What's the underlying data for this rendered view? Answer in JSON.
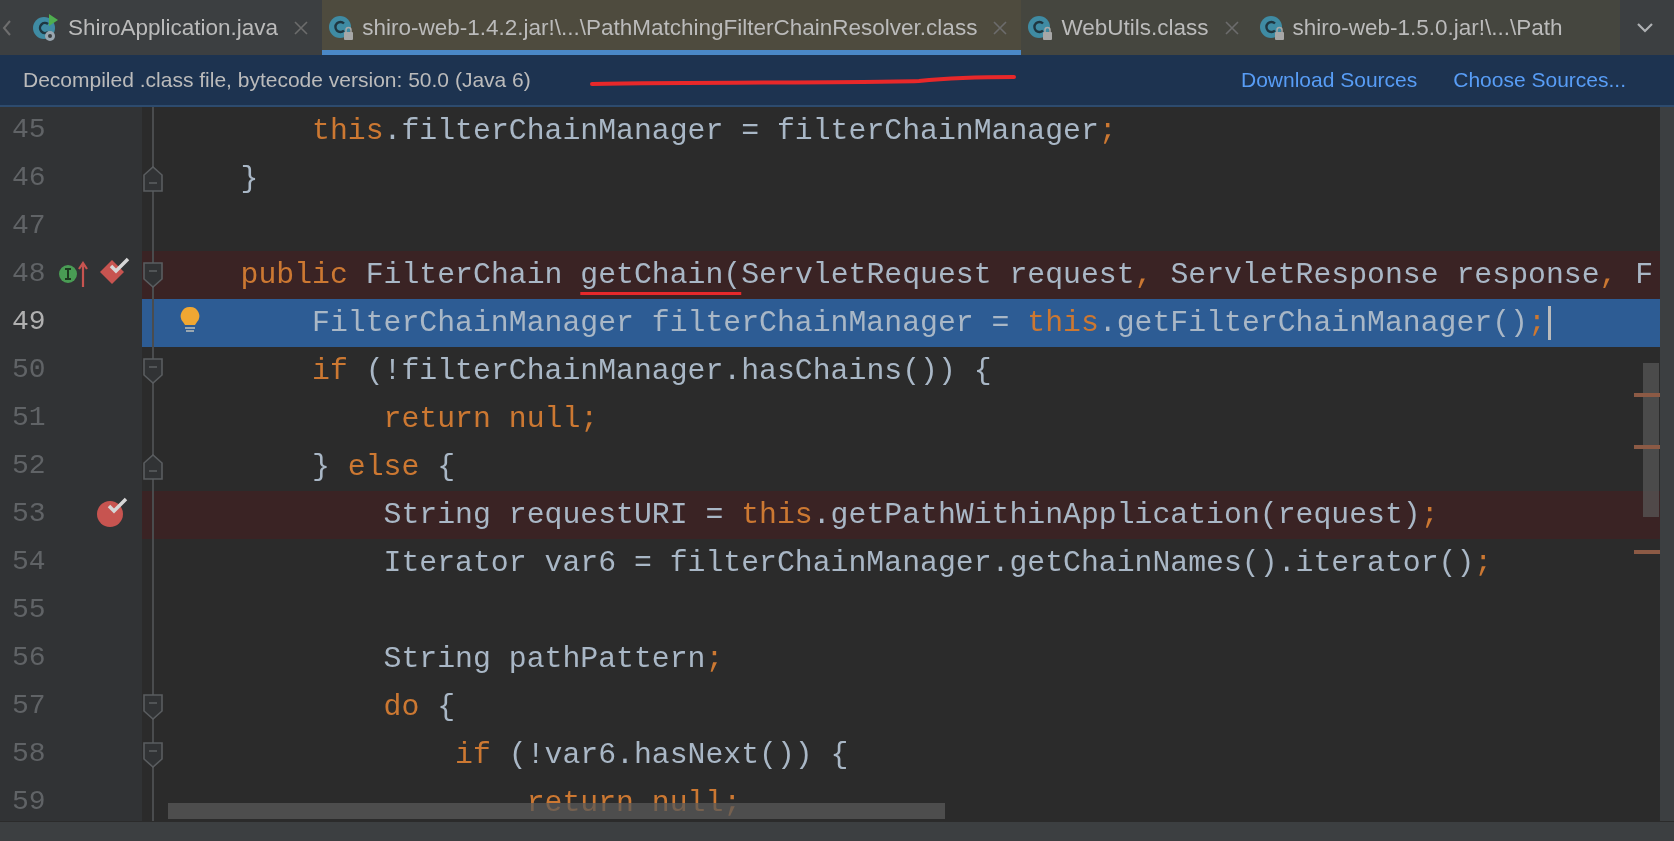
{
  "tabs": [
    {
      "label": "ShiroApplication.java",
      "kind": "java-source",
      "selected": false,
      "closable": true
    },
    {
      "label": "shiro-web-1.4.2.jar!\\...\\PathMatchingFilterChainResolver.class",
      "kind": "class",
      "selected": true,
      "closable": true
    },
    {
      "label": "WebUtils.class",
      "kind": "class",
      "selected": false,
      "closable": true
    },
    {
      "label": "shiro-web-1.5.0.jar!\\...\\Path",
      "kind": "class",
      "selected": false,
      "closable": false
    }
  ],
  "banner": {
    "message": "Decompiled .class file, bytecode version: 50.0 (Java 6)",
    "underline_mark": true,
    "actions": [
      "Download Sources",
      "Choose Sources..."
    ]
  },
  "editor": {
    "lines": [
      {
        "number": "45",
        "breakpoint": false,
        "current": false,
        "tokens": [
          {
            "text": "        this",
            "kind": "keyword"
          },
          {
            "text": ".filterChainManager = filterChainManager",
            "kind": "plain"
          },
          {
            "text": ";",
            "kind": "keyword"
          }
        ]
      },
      {
        "number": "46",
        "breakpoint": false,
        "current": false,
        "fold_end": true,
        "tokens": [
          {
            "text": "    }",
            "kind": "plain"
          }
        ]
      },
      {
        "number": "47",
        "breakpoint": false,
        "current": false
      },
      {
        "number": "48",
        "breakpoint": true,
        "current": false,
        "fold_start": true,
        "implements": true,
        "method_breakpoint": true,
        "tokens": [
          {
            "text": "    public",
            "kind": "keyword"
          },
          {
            "text": " FilterChain ",
            "kind": "plain"
          },
          {
            "text": "getChain(",
            "kind": "plain",
            "underlined": true
          },
          {
            "text": "ServletRequest request",
            "kind": "plain"
          },
          {
            "text": ",",
            "kind": "keyword"
          },
          {
            "text": " ServletResponse response",
            "kind": "plain"
          },
          {
            "text": ",",
            "kind": "keyword"
          },
          {
            "text": " F",
            "kind": "plain"
          }
        ]
      },
      {
        "number": "49",
        "breakpoint": false,
        "current": true,
        "intention": true,
        "tokens": [
          {
            "text": "        FilterChainManager filterChainManager = ",
            "kind": "plain"
          },
          {
            "text": "this",
            "kind": "keyword"
          },
          {
            "text": ".getFilterChainManager()",
            "kind": "plain"
          },
          {
            "text": ";",
            "kind": "keyword"
          }
        ]
      },
      {
        "number": "50",
        "breakpoint": false,
        "current": false,
        "fold_start": true,
        "tokens": [
          {
            "text": "        if",
            "kind": "keyword"
          },
          {
            "text": " (!filterChainManager.hasChains()) {",
            "kind": "plain"
          }
        ]
      },
      {
        "number": "51",
        "breakpoint": false,
        "current": false,
        "tokens": [
          {
            "text": "            return null;",
            "kind": "keyword"
          }
        ]
      },
      {
        "number": "52",
        "breakpoint": false,
        "current": false,
        "fold_end": true,
        "tokens": [
          {
            "text": "        } ",
            "kind": "plain"
          },
          {
            "text": "else",
            "kind": "keyword"
          },
          {
            "text": " {",
            "kind": "plain"
          }
        ]
      },
      {
        "number": "53",
        "breakpoint": true,
        "current": false,
        "line_breakpoint": true,
        "tokens": [
          {
            "text": "            String requestURI = ",
            "kind": "plain"
          },
          {
            "text": "this",
            "kind": "keyword"
          },
          {
            "text": ".getPathWithinApplication(request)",
            "kind": "plain"
          },
          {
            "text": ";",
            "kind": "keyword"
          }
        ]
      },
      {
        "number": "54",
        "breakpoint": false,
        "current": false,
        "tokens": [
          {
            "text": "            Iterator var6 = filterChainManager.getChainNames().iterator()",
            "kind": "plain"
          },
          {
            "text": ";",
            "kind": "keyword"
          }
        ]
      },
      {
        "number": "55",
        "breakpoint": false,
        "current": false
      },
      {
        "number": "56",
        "breakpoint": false,
        "current": false,
        "tokens": [
          {
            "text": "            String pathPattern",
            "kind": "plain"
          },
          {
            "text": ";",
            "kind": "keyword"
          }
        ]
      },
      {
        "number": "57",
        "breakpoint": false,
        "current": false,
        "fold_start": true,
        "tokens": [
          {
            "text": "            do",
            "kind": "keyword"
          },
          {
            "text": " {",
            "kind": "plain"
          }
        ]
      },
      {
        "number": "58",
        "breakpoint": false,
        "current": false,
        "fold_start": true,
        "tokens": [
          {
            "text": "                if",
            "kind": "keyword"
          },
          {
            "text": " (!var6.hasNext()) {",
            "kind": "plain"
          }
        ]
      },
      {
        "number": "59",
        "breakpoint": false,
        "current": false,
        "tokens": [
          {
            "text": "                    return null;",
            "kind": "keyword"
          }
        ]
      }
    ]
  }
}
